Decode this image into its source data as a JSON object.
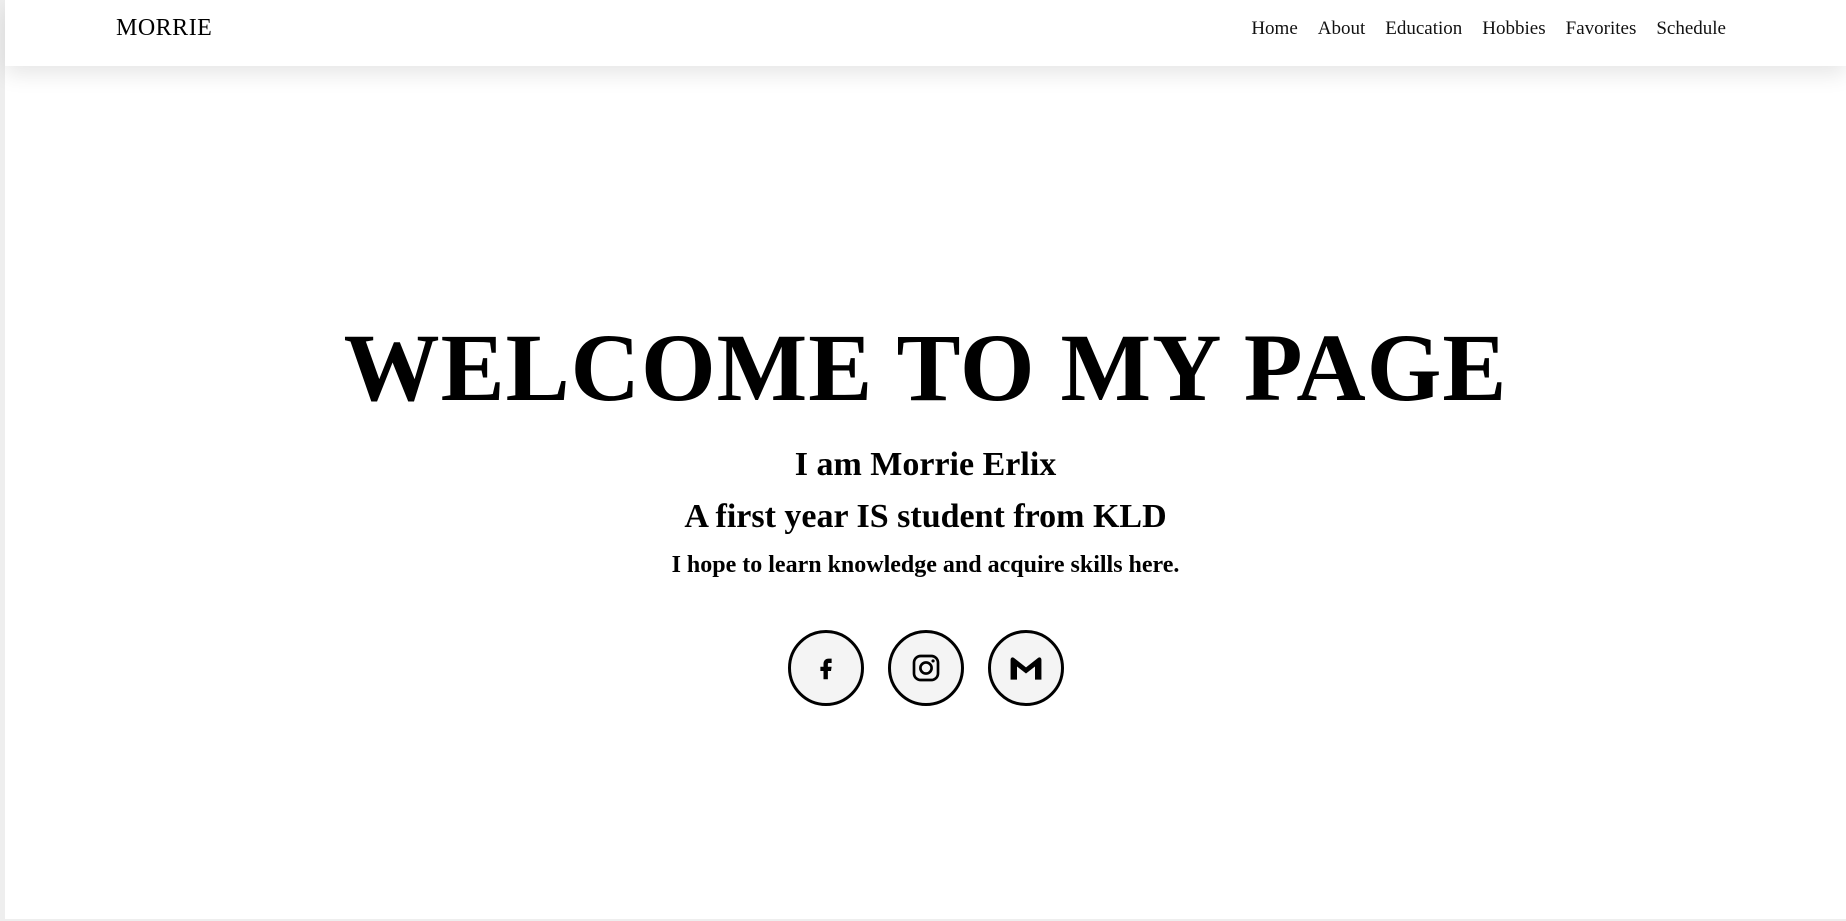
{
  "navbar": {
    "brand": "MORRIE",
    "links": [
      "Home",
      "About",
      "Education",
      "Hobbies",
      "Favorites",
      "Schedule"
    ]
  },
  "hero": {
    "title": "WELCOME TO MY PAGE",
    "line1": "I am Morrie Erlix",
    "line2": "A first year IS student from KLD",
    "line3": "I hope to learn knowledge and acquire skills here."
  },
  "socials": [
    {
      "icon": "facebook-icon"
    },
    {
      "icon": "instagram-icon"
    },
    {
      "icon": "gmail-icon"
    }
  ],
  "colors": {
    "text": "#000000",
    "background": "#ffffff",
    "social_bg": "#f4f4f4"
  }
}
